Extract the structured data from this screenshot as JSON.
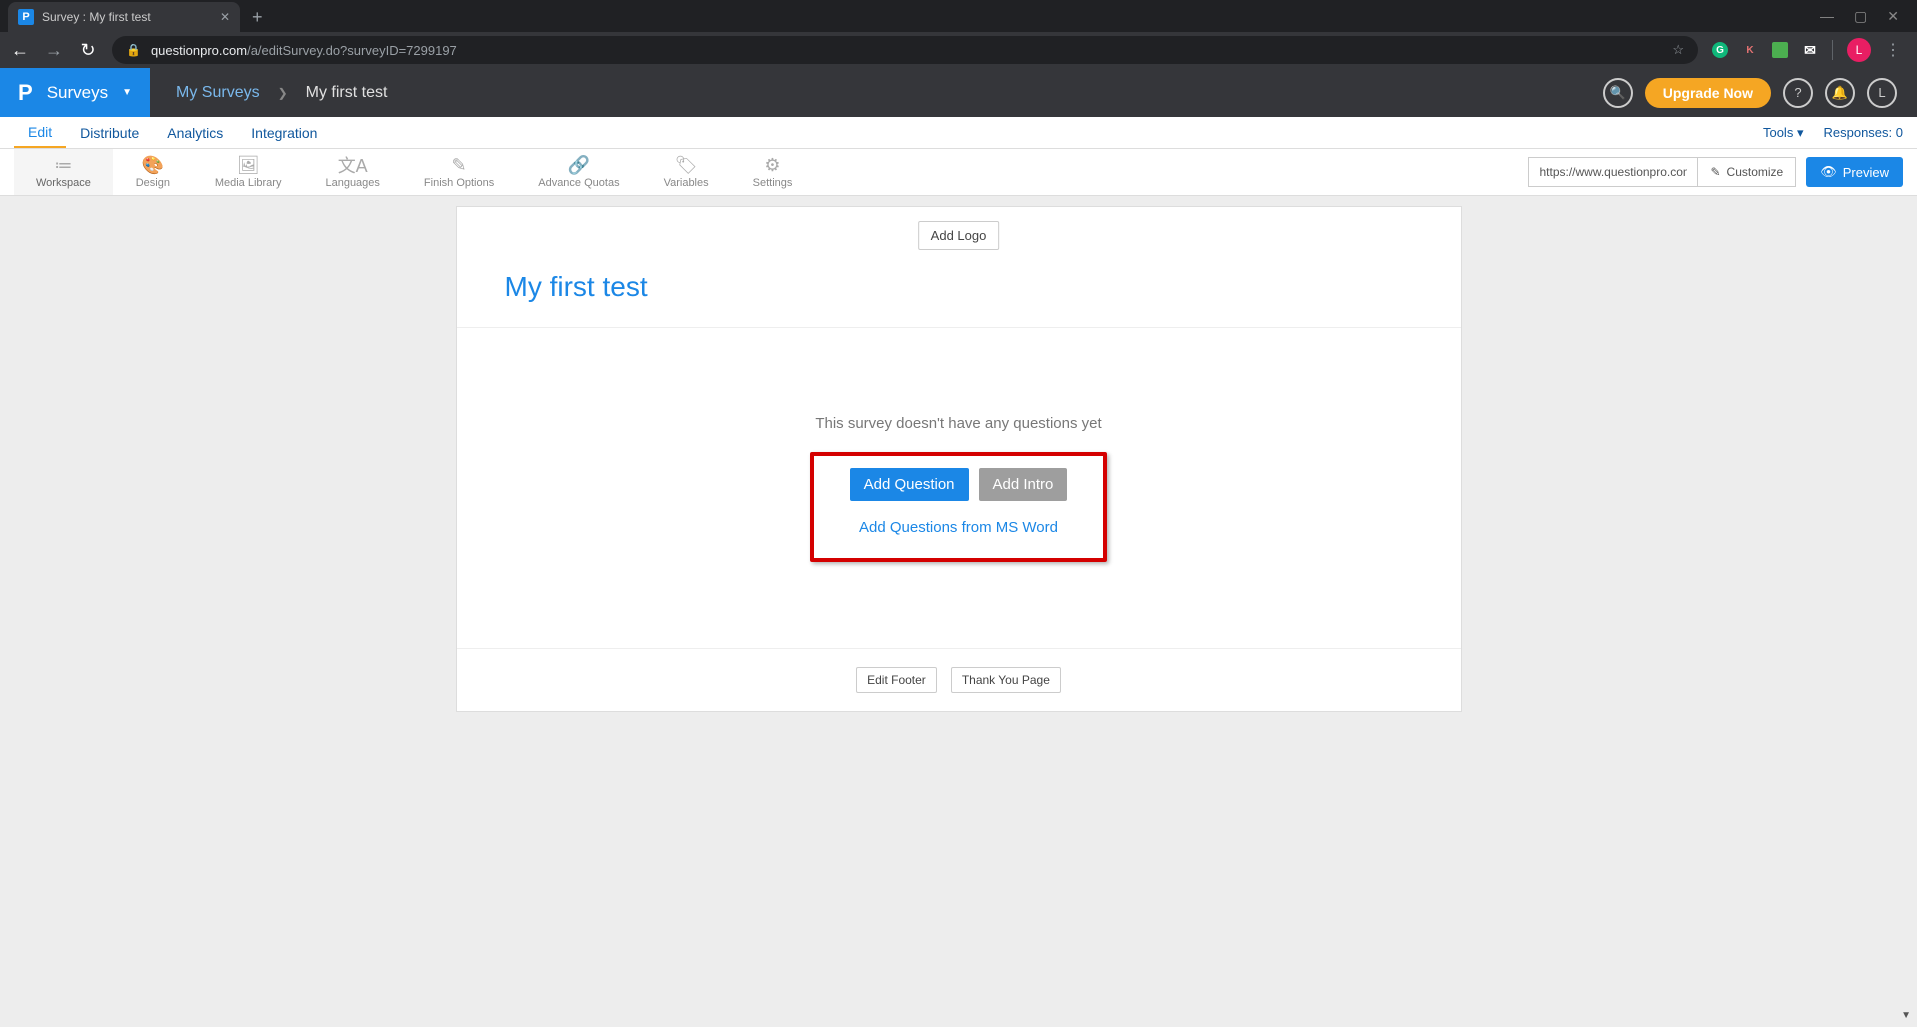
{
  "browser": {
    "tab": {
      "favicon_letter": "P",
      "title": "Survey : My first test"
    },
    "new_tab": "+",
    "win": {
      "min": "—",
      "max": "▢",
      "close": "✕"
    },
    "nav": {
      "back": "←",
      "forward": "→",
      "reload": "↻"
    },
    "address": {
      "lock": "🔒",
      "domain": "questionpro.com",
      "path": "/a/editSurvey.do?surveyID=7299197",
      "star": "☆"
    },
    "ext": {
      "g": "G",
      "k": "K",
      "mail": "✉"
    },
    "avatar": "L",
    "menu": "⋮"
  },
  "app_header": {
    "logo_letter": "P",
    "surveys_label": "Surveys",
    "chevron": "▼",
    "breadcrumb": {
      "root": "My Surveys",
      "chevron": "❯",
      "current": "My first test"
    },
    "search": "🔍",
    "upgrade": "Upgrade Now",
    "help": "?",
    "bell": "🔔",
    "avatar": "L"
  },
  "subnav": {
    "items": [
      "Edit",
      "Distribute",
      "Analytics",
      "Integration"
    ],
    "tools": "Tools",
    "tools_chevron": "▾",
    "responses_label": "Responses:",
    "responses_count": "0"
  },
  "ribbon": {
    "items": [
      {
        "icon": "≔",
        "label": "Workspace"
      },
      {
        "icon": "🎨",
        "label": "Design"
      },
      {
        "icon": "🖼",
        "label": "Media Library"
      },
      {
        "icon": "文A",
        "label": "Languages"
      },
      {
        "icon": "✎",
        "label": "Finish Options"
      },
      {
        "icon": "🔗",
        "label": "Advance Quotas"
      },
      {
        "icon": "🏷",
        "label": "Variables"
      },
      {
        "icon": "⚙",
        "label": "Settings"
      }
    ],
    "url_value": "https://www.questionpro.com",
    "customize": "Customize",
    "customize_icon": "✎",
    "preview": "Preview",
    "preview_icon": "👁"
  },
  "survey": {
    "add_logo": "Add Logo",
    "title": "My first test",
    "empty_text": "This survey doesn't have any questions yet",
    "add_question": "Add Question",
    "add_intro": "Add Intro",
    "ms_word": "Add Questions from MS Word",
    "edit_footer": "Edit Footer",
    "thank_you": "Thank You Page"
  }
}
